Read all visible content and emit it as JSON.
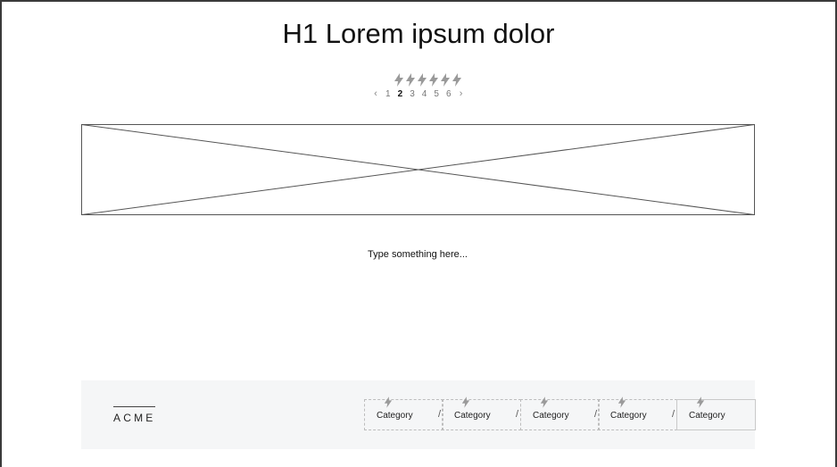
{
  "page": {
    "title": "H1 Lorem ipsum dolor",
    "note": "Type something here..."
  },
  "rating": {
    "icon": "lightning-bolt-icon",
    "count": 6,
    "color": "#9a9a9a"
  },
  "pagination": {
    "prev_label": "‹",
    "next_label": "›",
    "pages": [
      "1",
      "2",
      "3",
      "4",
      "5",
      "6"
    ],
    "current": "2"
  },
  "hero_image": {
    "icon": "image-placeholder"
  },
  "footer": {
    "logo": "ACME",
    "separator": "/",
    "categories": [
      {
        "label": "Category",
        "icon": "lightning-bolt-icon"
      },
      {
        "label": "Category",
        "icon": "lightning-bolt-icon"
      },
      {
        "label": "Category",
        "icon": "lightning-bolt-icon"
      },
      {
        "label": "Category",
        "icon": "lightning-bolt-icon"
      },
      {
        "label": "Category",
        "icon": "lightning-bolt-icon"
      }
    ]
  }
}
